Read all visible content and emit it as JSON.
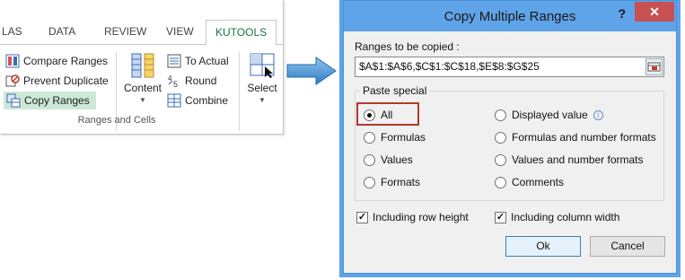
{
  "ribbon": {
    "tabs": [
      "LAS",
      "DATA",
      "REVIEW",
      "VIEW",
      "KUTOOLS"
    ],
    "left_items": [
      "Compare Ranges",
      "Prevent Duplicate",
      "Copy Ranges"
    ],
    "content_label": "Content",
    "right_items": [
      "To Actual",
      "Round",
      "Combine"
    ],
    "select_label": "Select",
    "group_label": "Ranges and Cells",
    "accent": "#1e7145"
  },
  "dialog": {
    "title": "Copy Multiple Ranges",
    "help": "?",
    "close": "✕",
    "ranges_label": "Ranges to be copied :",
    "ranges_value": "$A$1:$A$6,$C$1:$C$18,$E$8:$G$25",
    "paste_special_label": "Paste special",
    "options_left": [
      "All",
      "Formulas",
      "Values",
      "Formats"
    ],
    "options_right": [
      "Displayed value",
      "Formulas and number formats",
      "Values and number formats",
      "Comments"
    ],
    "selected_option": "All",
    "check_row_height": "Including row height",
    "check_col_width": "Including column width",
    "ok_label": "Ok",
    "cancel_label": "Cancel",
    "title_color": "#5fa3e8",
    "highlight_color": "#b03a2e"
  }
}
